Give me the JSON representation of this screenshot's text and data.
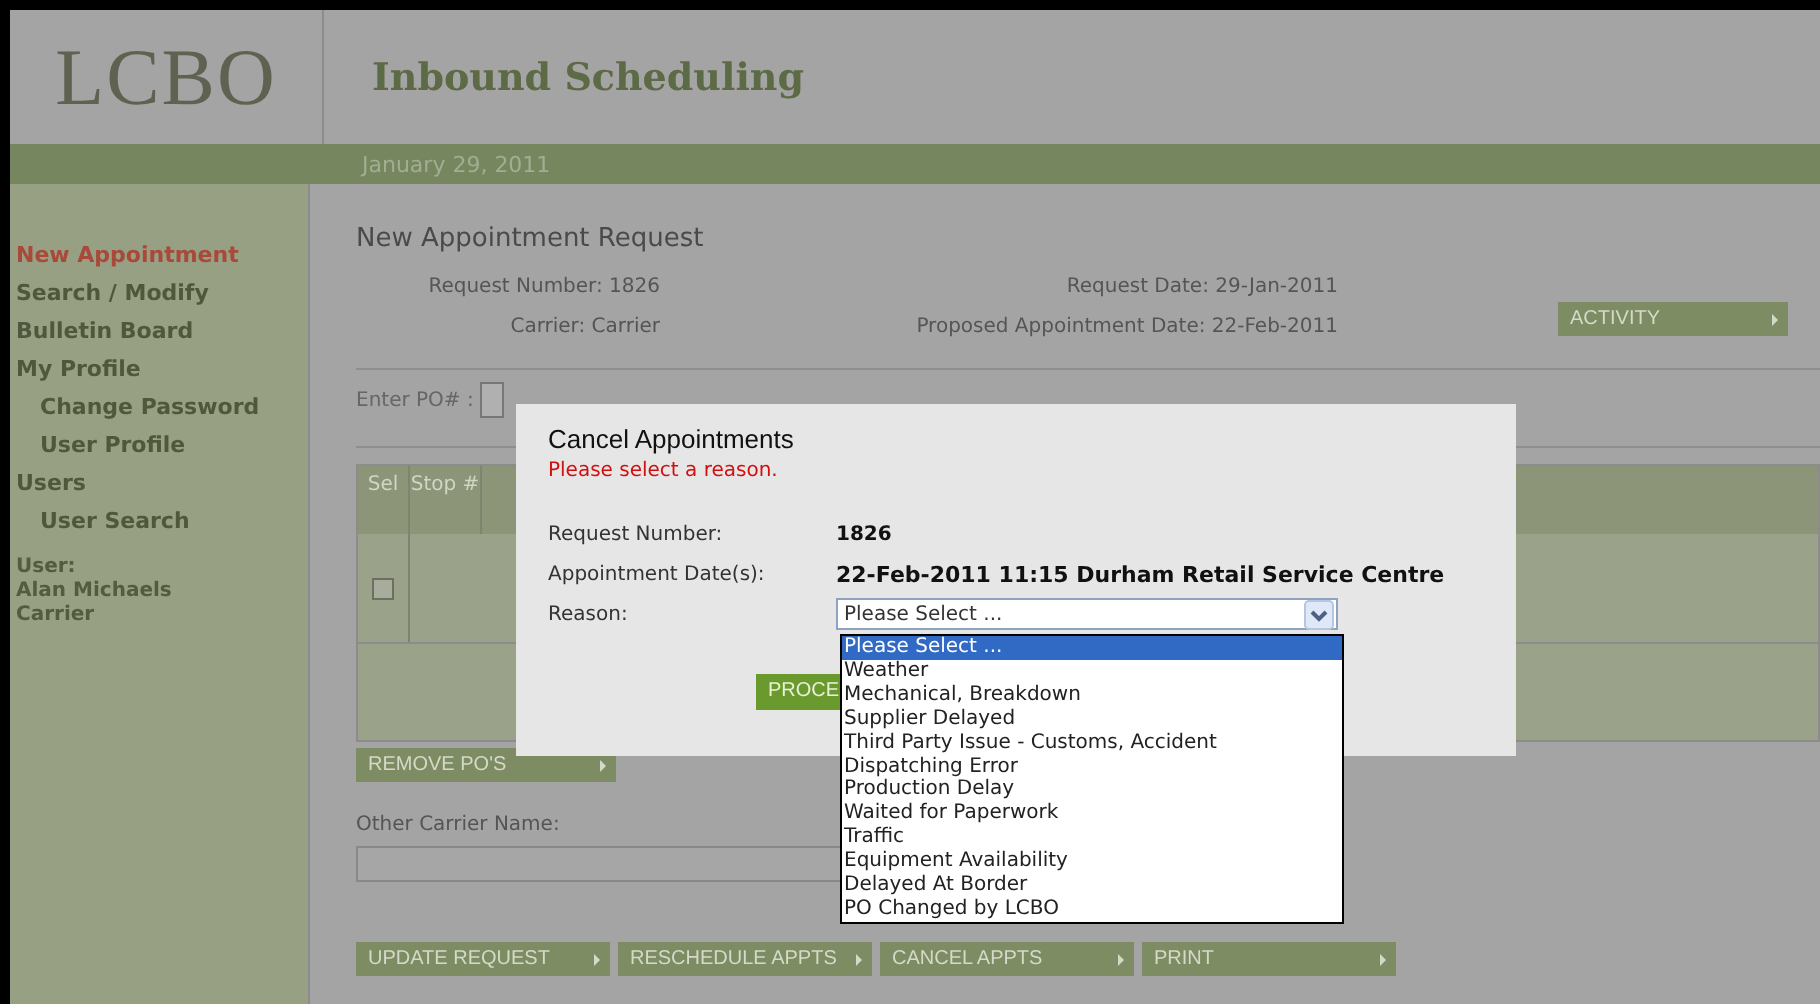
{
  "logo": "LCBO",
  "app_title": "Inbound Scheduling",
  "date_bar": "January 29, 2011",
  "sidebar": {
    "items": [
      {
        "label": "New Appointment",
        "selected": true
      },
      {
        "label": "Search / Modify",
        "selected": false
      },
      {
        "label": "Bulletin Board",
        "selected": false
      },
      {
        "label": "My Profile",
        "selected": false,
        "children": [
          {
            "label": "Change Password",
            "selected": false
          },
          {
            "label": "User Profile",
            "selected": false
          }
        ]
      },
      {
        "label": "Users",
        "selected": false,
        "children": [
          {
            "label": "User Search",
            "selected": false
          }
        ]
      }
    ],
    "user": [
      "User:",
      "Alan Michaels",
      "Carrier"
    ]
  },
  "request": {
    "heading": "New Appointment Request",
    "left": [
      {
        "label": "Request Number:",
        "value": "1826"
      },
      {
        "label": "Carrier:",
        "value": "Carrier"
      }
    ],
    "right": [
      {
        "label": "Request Date:",
        "value": "29-Jan-2011"
      },
      {
        "label": "Proposed Appointment Date:",
        "value": "22-Feb-2011"
      }
    ],
    "activity_button": "ACTIVITY"
  },
  "po_label": "Enter PO# :",
  "table": {
    "columns": [
      "Sel",
      "Stop #"
    ],
    "rows": [
      {
        "checked": false
      }
    ]
  },
  "remove_button": "REMOVE PO'S",
  "other_carrier": {
    "label": "Other Carrier Name:"
  },
  "bottom_buttons": [
    "UPDATE REQUEST",
    "RESCHEDULE APPTS",
    "CANCEL APPTS",
    "PRINT"
  ],
  "dialog": {
    "title": "Cancel Appointments",
    "error": "Please select a reason.",
    "fields": [
      {
        "label": "Request Number:",
        "value": "1826"
      },
      {
        "label": "Appointment Date(s):",
        "value": "22-Feb-2011 11:15  Durham Retail Service Centre"
      }
    ],
    "reason_label": "Reason:",
    "reason_value": "Please Select ...",
    "proceed_button": "PROCE",
    "options": [
      {
        "label": "Please Select ...",
        "selected": true
      },
      {
        "label": "Weather",
        "selected": false
      },
      {
        "label": "Mechanical, Breakdown",
        "selected": false
      },
      {
        "label": "Supplier Delayed",
        "selected": false
      },
      {
        "label": "Third Party Issue - Customs, Accident",
        "selected": false
      },
      {
        "label": "Dispatching Error",
        "selected": false
      },
      {
        "label": "Production Delay",
        "selected": false
      },
      {
        "label": "Waited for Paperwork",
        "selected": false
      },
      {
        "label": "Traffic",
        "selected": false
      },
      {
        "label": "Equipment Availability",
        "selected": false
      },
      {
        "label": "Delayed At Border",
        "selected": false
      },
      {
        "label": "PO Changed by LCBO",
        "selected": false
      }
    ]
  }
}
